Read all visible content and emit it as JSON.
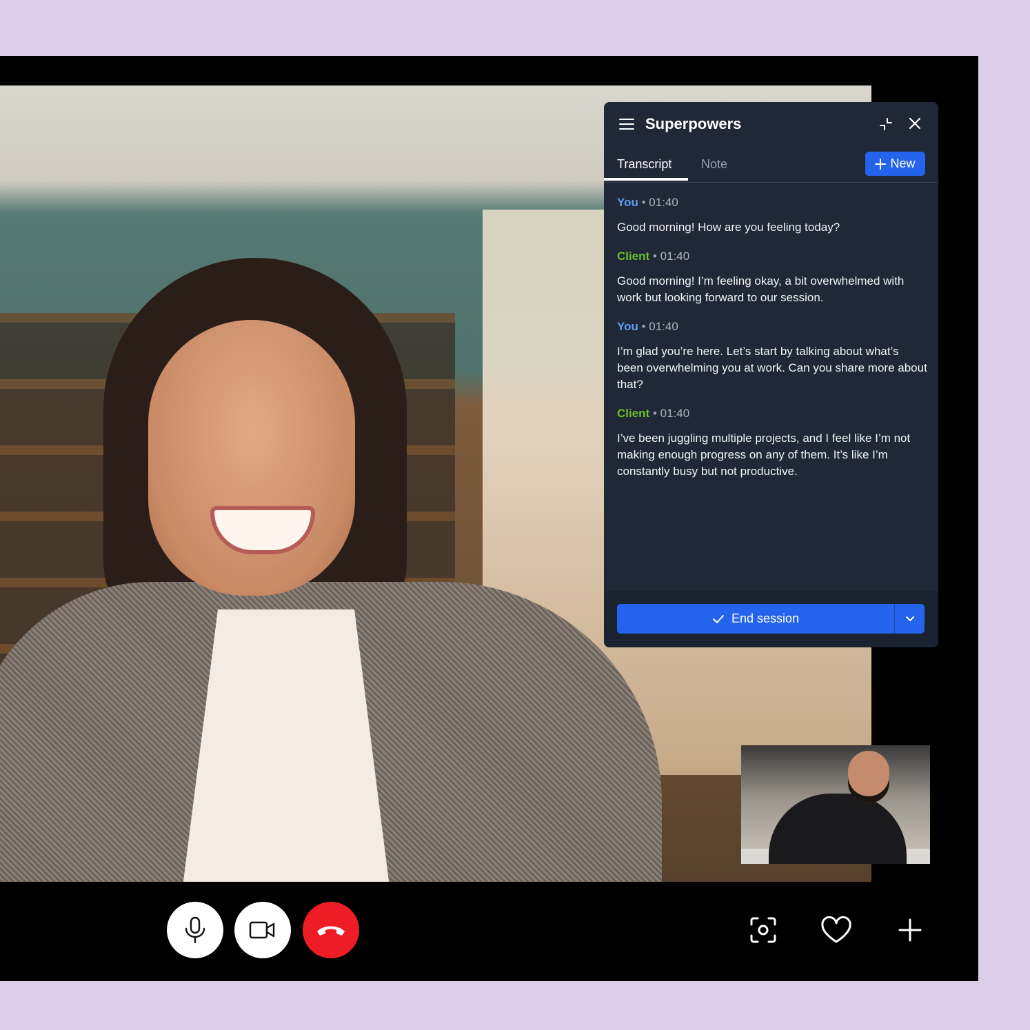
{
  "panel": {
    "title": "Superpowers",
    "tabs": [
      {
        "label": "Transcript",
        "active": true
      },
      {
        "label": "Note",
        "active": false
      }
    ],
    "new_label": "New",
    "messages": [
      {
        "speaker": "You",
        "separator": "•",
        "time": "01:40",
        "text": "Good morning! How are you feeling today?"
      },
      {
        "speaker": "Client",
        "separator": "•",
        "time": "01:40",
        "text": "Good morning! I’m feeling okay, a bit overwhelmed with work but looking forward to our session."
      },
      {
        "speaker": "You",
        "separator": "•",
        "time": "01:40",
        "text": "I’m glad you’re here. Let’s start by talking about what’s been overwhelming you at work. Can you share more about that?"
      },
      {
        "speaker": "Client",
        "separator": "•",
        "time": "01:40",
        "text": "I’ve been juggling multiple projects, and I feel like I’m not making enough progress on any of them. It’s like I’m constantly busy but not productive."
      }
    ],
    "end_session_label": "End session"
  },
  "icons": {
    "menu": "menu-icon",
    "minimize": "minimize-icon",
    "close": "close-icon",
    "plus": "plus-icon",
    "check": "check-icon",
    "chevron": "chevron-down-icon",
    "mic": "microphone-icon",
    "camera": "video-camera-icon",
    "hangup": "hang-up-icon",
    "screenshot": "screenshot-icon",
    "heart": "heart-icon",
    "add": "add-icon"
  },
  "colors": {
    "accent": "#2463eb",
    "you": "#5b9ef6",
    "client": "#6cbf2c",
    "hangup": "#ed1c25",
    "background": "#dccde9"
  }
}
